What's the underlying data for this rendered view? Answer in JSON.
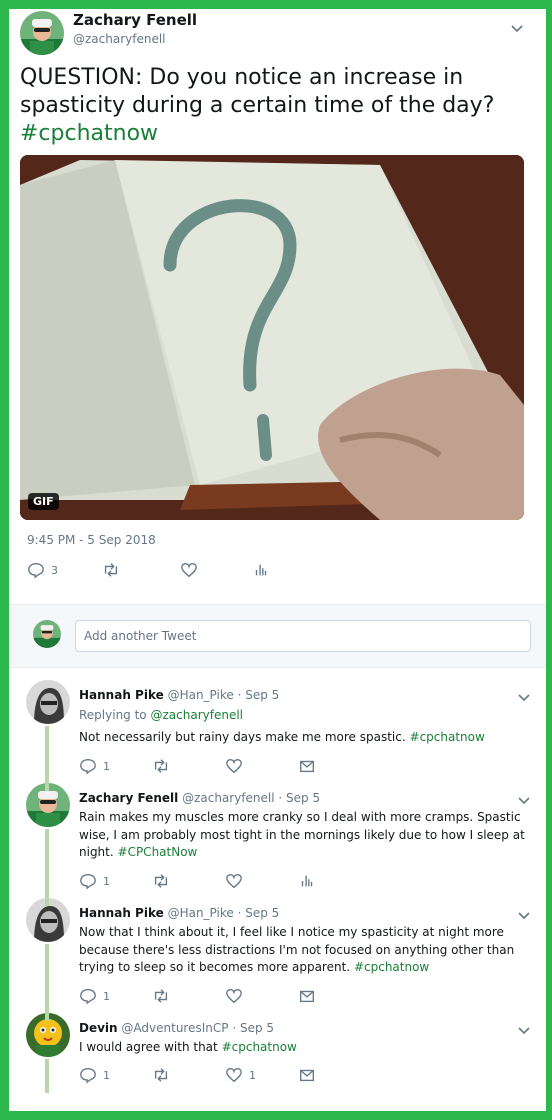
{
  "main_tweet": {
    "author_name": "Zachary Fenell",
    "author_handle": "@zacharyfenell",
    "text_plain": "QUESTION: Do you notice an increase in spasticity during a certain time of the day?",
    "hashtag": "#cpchatnow",
    "media_badge": "GIF",
    "timestamp": "9:45 PM - 5 Sep 2018",
    "reply_count": "3",
    "accent_color": "#1a7f37"
  },
  "compose": {
    "placeholder": "Add another Tweet"
  },
  "replies": [
    {
      "name": "Hannah Pike",
      "handle": "@Han_Pike",
      "date": "· Sep 5",
      "replying_prefix": "Replying to",
      "replying_to": "@zacharyfenell",
      "text_plain": "Not necessarily but rainy days make me more spastic.",
      "hashtag": "#cpchatnow",
      "reply_count": "1",
      "like_count": ""
    },
    {
      "name": "Zachary Fenell",
      "handle": "@zacharyfenell",
      "date": "· Sep 5",
      "text_plain": "Rain makes my muscles more cranky so I deal with more cramps. Spastic wise, I am probably most tight in the mornings likely due to how I sleep at night.",
      "hashtag": "#CPChatNow",
      "reply_count": "1",
      "like_count": ""
    },
    {
      "name": "Hannah Pike",
      "handle": "@Han_Pike",
      "date": "· Sep 5",
      "text_plain": "Now that I think about it, I feel like I notice my spasticity at night more because there's less distractions I'm not focused on anything other than trying to sleep so it becomes more apparent.",
      "hashtag": "#cpchatnow",
      "reply_count": "1",
      "like_count": ""
    },
    {
      "name": "Devin",
      "handle": "@AdventuresInCP",
      "date": "· Sep 5",
      "text_plain": "I would agree with that",
      "hashtag": "#cpchatnow",
      "reply_count": "1",
      "like_count": "1"
    }
  ],
  "icons": [
    "reply-icon",
    "retweet-icon",
    "like-icon",
    "analytics-icon",
    "message-icon",
    "chevron-down-icon",
    "gif-badge"
  ],
  "colors": {
    "frame_border": "#2db84d",
    "hashtag": "#1a7f37",
    "muted_text": "#657786",
    "thread_line": "#b7d8a6"
  }
}
